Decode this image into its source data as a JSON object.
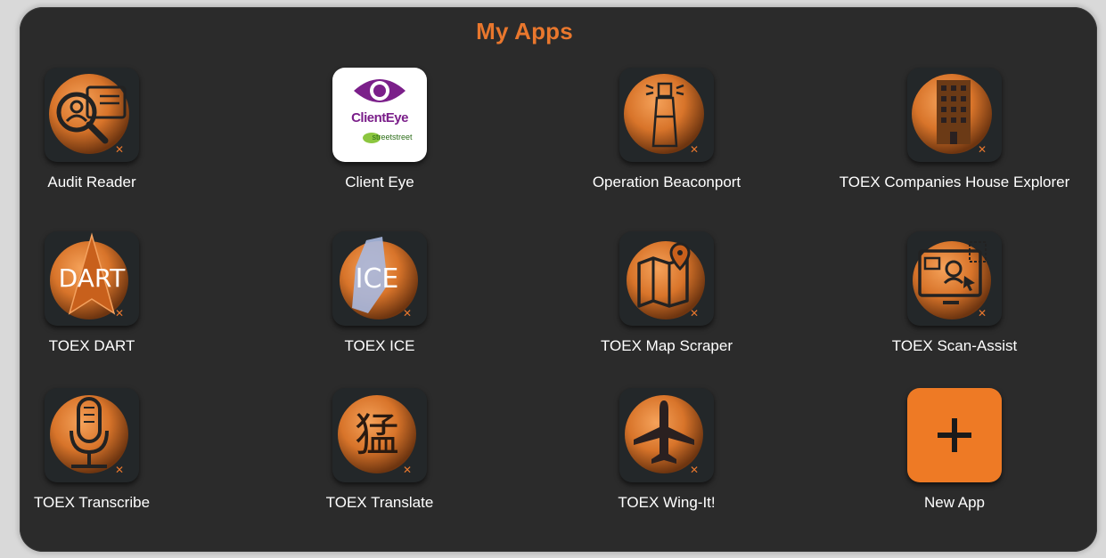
{
  "header": {
    "title": "My Apps"
  },
  "apps": [
    {
      "label": "Audit Reader",
      "icon": "audit-reader-icon"
    },
    {
      "label": "Client Eye",
      "icon": "client-eye-logo",
      "logo_text": "ClientEye",
      "logo_subtext": "streetstreet"
    },
    {
      "label": "Operation Beaconport",
      "icon": "lighthouse-icon"
    },
    {
      "label": "TOEX Companies House Explorer",
      "icon": "building-icon"
    },
    {
      "label": "TOEX DART",
      "icon": "dart-icon",
      "icon_text": "DART"
    },
    {
      "label": "TOEX ICE",
      "icon": "ice-icon",
      "icon_text": "ICE"
    },
    {
      "label": "TOEX Map Scraper",
      "icon": "map-pin-icon"
    },
    {
      "label": "TOEX Scan-Assist",
      "icon": "screen-scan-icon"
    },
    {
      "label": "TOEX Transcribe",
      "icon": "microphone-icon"
    },
    {
      "label": "TOEX Translate",
      "icon": "chinese-character-icon",
      "icon_text": "猛"
    },
    {
      "label": "TOEX Wing-It!",
      "icon": "airplane-icon"
    },
    {
      "label": "New App",
      "icon": "plus-icon"
    }
  ],
  "colors": {
    "accent": "#e9772d",
    "panel": "#2b2b2b",
    "tile": "#232729",
    "new_app": "#ee7a25"
  }
}
